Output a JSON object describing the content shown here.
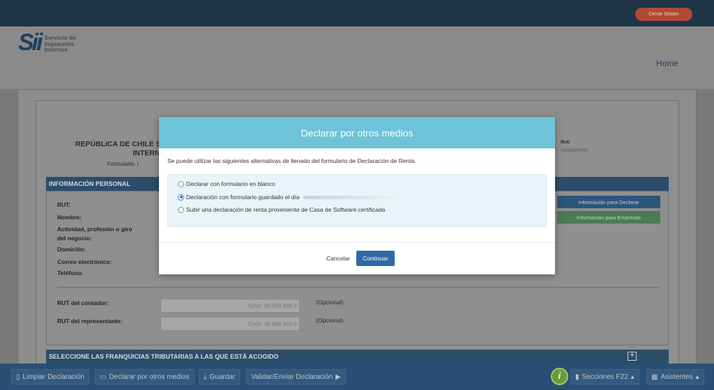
{
  "header": {
    "logout_label": "Cerrar Sesion",
    "logo_mark": "Sii",
    "logo_line1": "Servicio de",
    "logo_line2": "Impuestos",
    "logo_line3": "Internos",
    "home_label": "Home"
  },
  "form": {
    "title_line1": "REPÚBLICA DE CHILE SERV",
    "title_line2": "INTERN",
    "subtitle": "Formulario. I",
    "rut_label": "Rut:"
  },
  "personal": {
    "section_title": "INFORMACIÓN PERSONAL",
    "fields": {
      "rut": "RUT:",
      "nombre": "Nombre:",
      "actividad_1": "Actividad, profesión o giro",
      "actividad_2": "del negocio:",
      "domicilio": "Domicilio:",
      "correo": "Correo electrónico:",
      "telefono": "Teléfono:",
      "rut_contador": "RUT del contador:",
      "rut_representante": "RUT del representante:"
    },
    "placeholder": "Ejem: 99.999.999-9",
    "optional_label": "(Opcional)",
    "btn_info_declarar": "Información para Declarar",
    "btn_info_empresas": "Información para Empresas"
  },
  "franquicias": {
    "section_title": "SELECCIONE LAS FRANQUICIAS TRIBUTARIAS A LAS QUE ESTÁ ACOGIDO",
    "expand_symbol": "+"
  },
  "toolbar": {
    "limpiar": "Limpiar Declaración",
    "declarar_otros": "Declarar por otros medios",
    "guardar": "Guardar",
    "validar": "Validar/Enviar Declaración",
    "info_symbol": "i",
    "secciones": "Secciones F22",
    "asistentes": "Asistentes"
  },
  "modal": {
    "title": "Declarar por otros medios",
    "intro": "Se puede utilizar las siguientes alternativas de llenado del formulario de Declaración de Renta.",
    "options": [
      {
        "label": "Declarar con formulario en blanco",
        "selected": false
      },
      {
        "label": "Declaración con formulario guardado el día",
        "selected": true
      },
      {
        "label": "Subir una declaración de renta proveniente de Casa de Software certificada",
        "selected": false
      }
    ],
    "cancel_label": "Cancelar",
    "continue_label": "Continuar"
  },
  "colors": {
    "topbar": "#1f3447",
    "modal_header": "#6ec3d8",
    "primary_button": "#2e6aa4",
    "logout_button": "#b04a33",
    "toolbar": "#2a4f75"
  }
}
